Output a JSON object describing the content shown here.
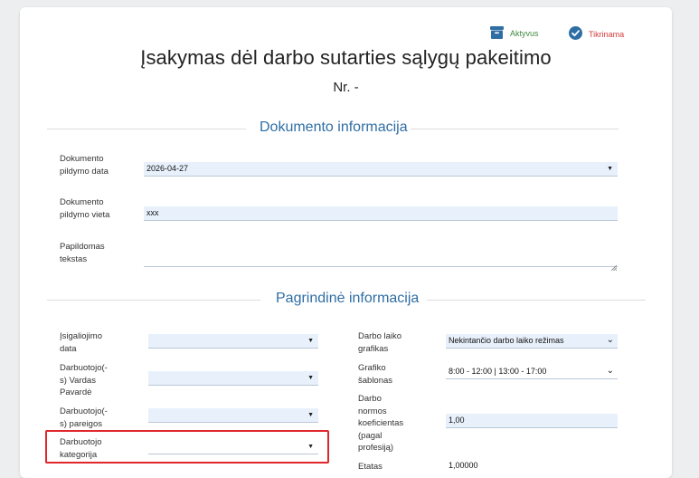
{
  "status": {
    "active": {
      "label": "Aktyvus",
      "color": "#3e8b3e",
      "icon": "archive-box-icon"
    },
    "checking": {
      "label": "Tikrinama",
      "color": "#d23b3b",
      "icon": "check-circle-icon"
    }
  },
  "document": {
    "title": "Įsakymas dėl darbo sutarties sąlygų pakeitimo",
    "number": "Nr. -"
  },
  "sections": {
    "doc_info": "Dokumento informacija",
    "main_info": "Pagrindinė informacija"
  },
  "doc_fields": {
    "date_label": "Dokumento pildymo data",
    "date_value": "2026-04-27",
    "place_label": "Dokumento pildymo vieta",
    "place_value": "xxx",
    "extra_label": "Papildomas tekstas",
    "extra_value": ""
  },
  "main_left": {
    "effective_label": "Įsigaliojimo data",
    "effective_value": "",
    "employee_label": "Darbuotojo(-s) Vardas Pavardė",
    "employee_value": "",
    "position_label": "Darbuotojo(-s) pareigos",
    "position_value": "",
    "category_label": "Darbuotojo kategorija",
    "category_value": ""
  },
  "main_right": {
    "schedule_label": "Darbo laiko grafikas",
    "schedule_value": "Nekintančio darbo laiko režimas",
    "template_label": "Grafiko šablonas",
    "template_value": "8:00 - 12:00 | 13:00 - 17:00",
    "coef_label": "Darbo normos koeficientas (pagal profesiją)",
    "coef_value": "1,00",
    "rate_label": "Etatas",
    "rate_value": "1,00000"
  },
  "colors": {
    "accent": "#2f6ea4",
    "field_bg": "#e8f1fb",
    "highlight": "#e0262a"
  }
}
